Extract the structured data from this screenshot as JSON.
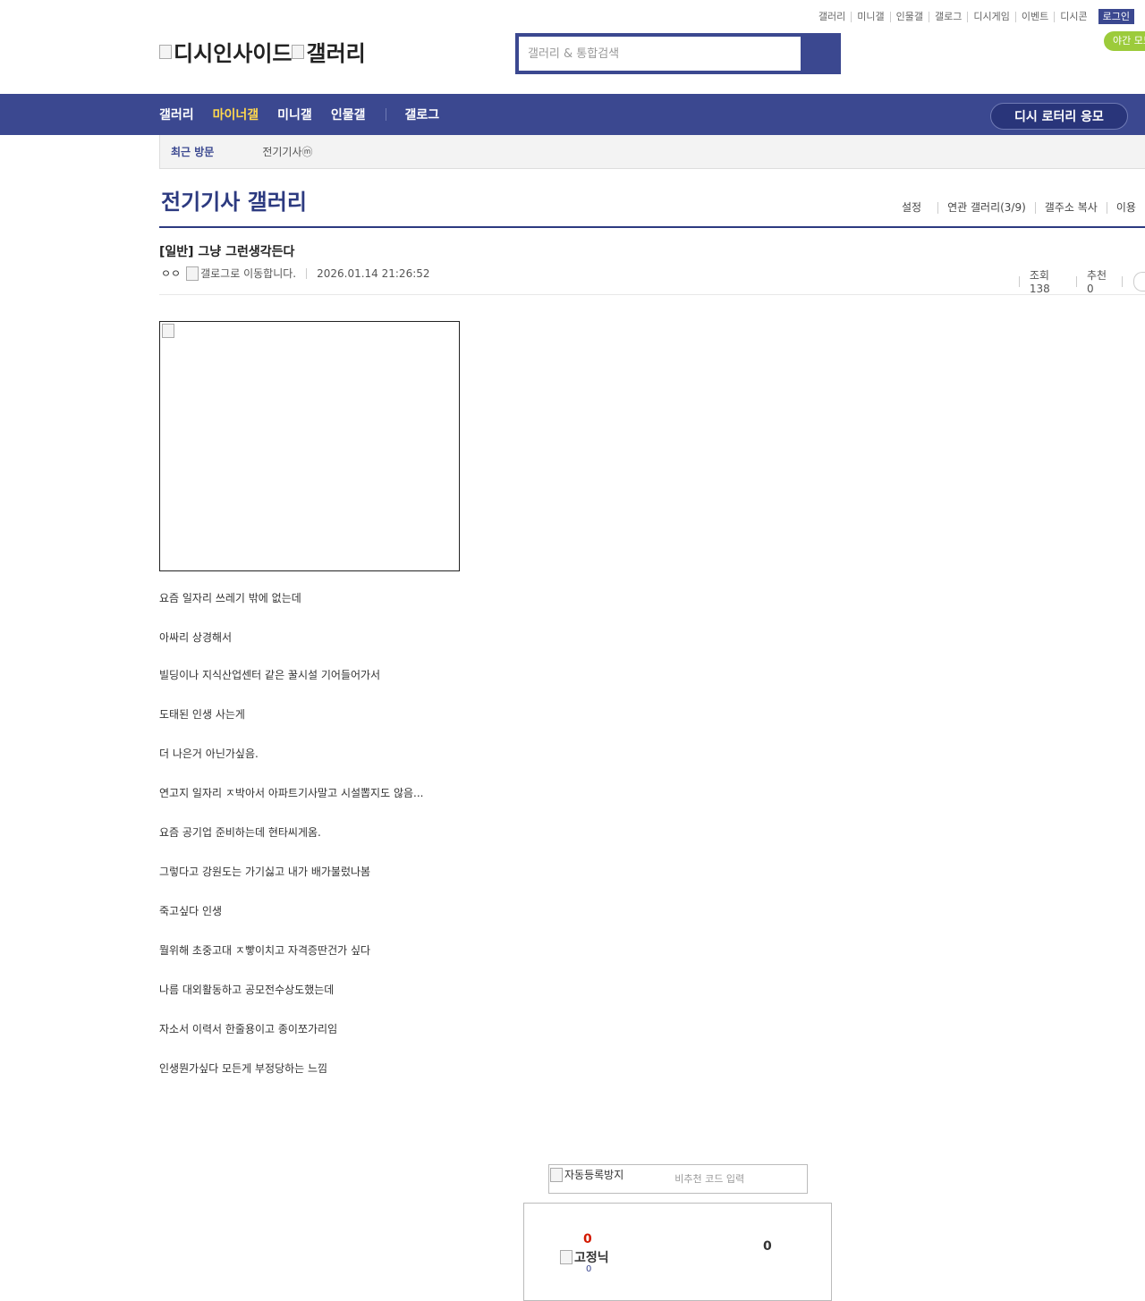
{
  "util_links": [
    "갤러리",
    "미니갤",
    "인물갤",
    "갤로그",
    "디시게임",
    "이벤트",
    "디시콘"
  ],
  "login_label": "로그인",
  "night_mode_label": "야간 모드",
  "logo": {
    "site_alt": "디시인사이드",
    "gallery_alt": "갤러리"
  },
  "search": {
    "placeholder": "갤러리 & 통합검색"
  },
  "gnb": {
    "items": [
      "갤러리",
      "마이너갤",
      "미니갤",
      "인물갤",
      "갤로그"
    ],
    "active": "마이너갤",
    "lotto_label": "디시 로터리 응모"
  },
  "recent": {
    "title": "최근 방문",
    "items": [
      "전기기사ⓜ"
    ]
  },
  "gallery": {
    "title": "전기기사 갤러리",
    "options": [
      "설정",
      "연관 갤러리(3/9)",
      "갤주소 복사",
      "이용"
    ]
  },
  "post": {
    "title": "[일반] 그냥 그런생각든다",
    "writer": "ㅇㅇ",
    "gallog_alt": "갤로그로 이동합니다.",
    "date": "2026.01.14 21:26:52",
    "views_label": "조회 138",
    "recommend_label": "추천 0",
    "body": [
      "요즘 일자리 쓰레기 밖에 없는데",
      "아싸리 상경해서",
      "빌딩이나 지식산업센터 같은 꿀시설 기어들어가서",
      "도태된 인생 사는게",
      "더 나은거 아닌가싶음.",
      "연고지 일자리 ㅈ박아서 아파트기사말고 시설뽑지도 않음...",
      "요즘 공기업 준비하는데 현타씨게옴.",
      "그렇다고 강원도는 가기싫고 내가 배가불렀나봄",
      "죽고싶다 인생",
      "뭘위해 초중고대 ㅈ빻이치고 자격증딴건가 싶다",
      "나름 대외활동하고 공모전수상도했는데",
      "자소서 이력서 한줄용이고 종이쪼가리임",
      "인생뭔가싶다 모든게 부정당하는 느낌"
    ]
  },
  "captcha": {
    "image_alt": "자동등록방지",
    "placeholder": "비추천 코드 입력"
  },
  "recommend_box": {
    "up_count": "0",
    "fixed_alt": "고정닉",
    "fixed_count": "0",
    "down_count": "0"
  }
}
